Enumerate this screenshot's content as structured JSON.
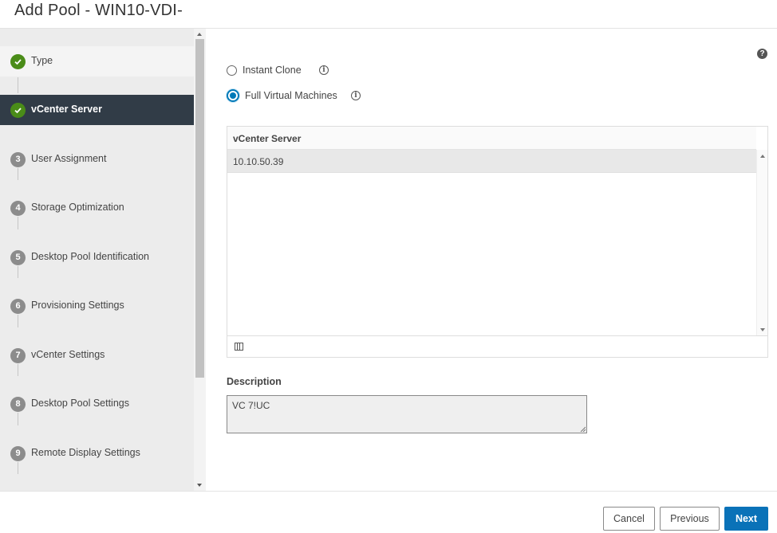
{
  "header": {
    "title": "Add Pool - WIN10-VDI-"
  },
  "sidebar": {
    "steps": [
      {
        "number": "",
        "label": "Type",
        "state": "done"
      },
      {
        "number": "",
        "label": "vCenter Server",
        "state": "active"
      },
      {
        "number": "3",
        "label": "User Assignment",
        "state": "pending"
      },
      {
        "number": "4",
        "label": "Storage Optimization",
        "state": "pending"
      },
      {
        "number": "5",
        "label": "Desktop Pool Identification",
        "state": "pending"
      },
      {
        "number": "6",
        "label": "Provisioning Settings",
        "state": "pending"
      },
      {
        "number": "7",
        "label": "vCenter Settings",
        "state": "pending"
      },
      {
        "number": "8",
        "label": "Desktop Pool Settings",
        "state": "pending"
      },
      {
        "number": "9",
        "label": "Remote Display Settings",
        "state": "pending"
      }
    ]
  },
  "content": {
    "help_icon": "?",
    "options": [
      {
        "label": "Instant Clone",
        "selected": false
      },
      {
        "label": "Full Virtual Machines",
        "selected": true
      }
    ],
    "info_icon": "i",
    "grid": {
      "column_header": "vCenter Server",
      "rows": [
        "10.10.50.39"
      ]
    },
    "description": {
      "label": "Description",
      "value": "VC 7!UC"
    }
  },
  "footer": {
    "cancel_label": "Cancel",
    "previous_label": "Previous",
    "next_label": "Next"
  },
  "colors": {
    "active_step_bg": "#313c47",
    "done_check": "#4a8c18",
    "primary_button": "#0a72b8",
    "radio_selected": "#0079b8"
  }
}
